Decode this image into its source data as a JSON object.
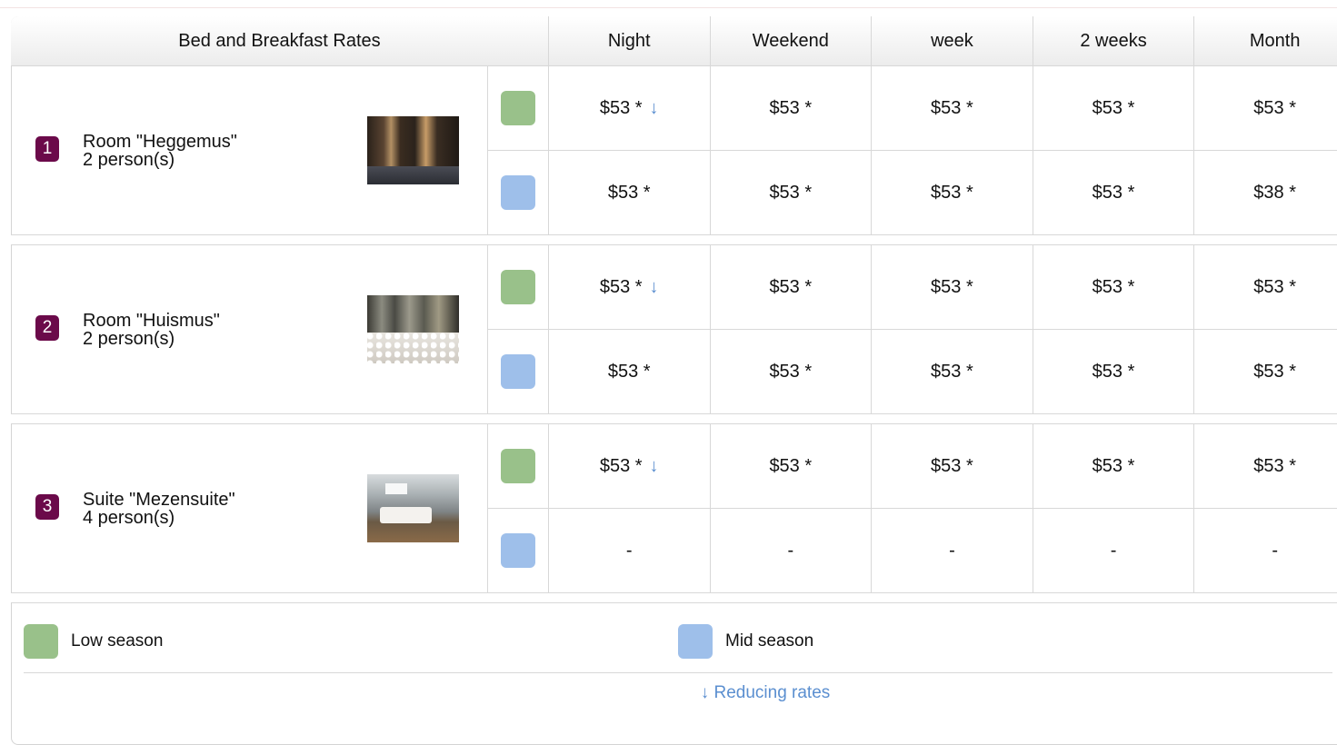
{
  "header": {
    "title": "Bed and Breakfast Rates",
    "columns": [
      "Night",
      "Weekend",
      "week",
      "2 weeks",
      "Month"
    ]
  },
  "colors": {
    "low_season": "#99c18a",
    "mid_season": "#9ebfea",
    "room_badge": "#6b0a4a",
    "reducing_arrow": "#5b8fd0"
  },
  "rooms": [
    {
      "number": "1",
      "name": "Room \"Heggemus\"",
      "capacity": "2 person(s)",
      "photo_icon": "room-photo",
      "low": [
        "$53 *",
        "$53 *",
        "$53 *",
        "$53 *",
        "$53 *"
      ],
      "low_arrow": "↓",
      "mid": [
        "$53 *",
        "$53 *",
        "$53 *",
        "$53 *",
        "$38 *"
      ]
    },
    {
      "number": "2",
      "name": "Room \"Huismus\"",
      "capacity": "2 person(s)",
      "photo_icon": "room-photo",
      "low": [
        "$53 *",
        "$53 *",
        "$53 *",
        "$53 *",
        "$53 *"
      ],
      "low_arrow": "↓",
      "mid": [
        "$53 *",
        "$53 *",
        "$53 *",
        "$53 *",
        "$53 *"
      ]
    },
    {
      "number": "3",
      "name": "Suite \"Mezensuite\"",
      "capacity": "4 person(s)",
      "photo_icon": "room-photo",
      "low": [
        "$53 *",
        "$53 *",
        "$53 *",
        "$53 *",
        "$53 *"
      ],
      "low_arrow": "↓",
      "mid": [
        "-",
        "-",
        "-",
        "-",
        "-"
      ]
    }
  ],
  "legend": {
    "low_label": "Low season",
    "mid_label": "Mid season",
    "note": "↓ Reducing rates"
  }
}
